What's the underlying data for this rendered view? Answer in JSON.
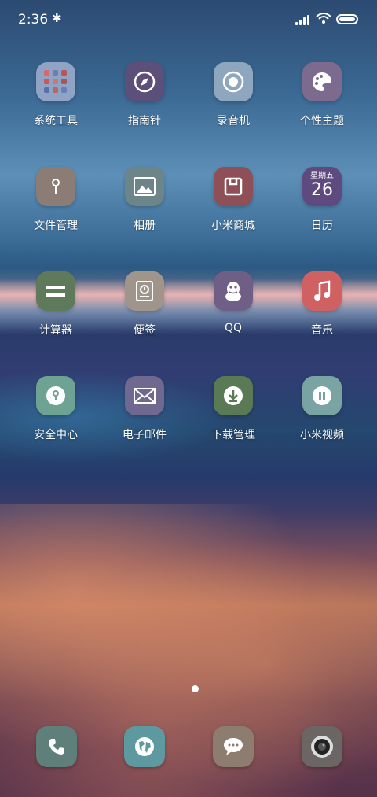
{
  "status_bar": {
    "time": "2:36",
    "bluetooth_icon": "bluetooth-icon"
  },
  "rows": [
    [
      {
        "label": "系统工具",
        "icon": "folder-grid-icon",
        "color": "#8fa3c4"
      },
      {
        "label": "指南针",
        "icon": "compass-icon",
        "color": "#5c4f7a"
      },
      {
        "label": "录音机",
        "icon": "recorder-icon",
        "color": "#8fa6bf"
      },
      {
        "label": "个性主题",
        "icon": "palette-icon",
        "color": "#7c6b8f"
      }
    ],
    [
      {
        "label": "文件管理",
        "icon": "file-manager-icon",
        "color": "#8b7c76"
      },
      {
        "label": "相册",
        "icon": "gallery-icon",
        "color": "#6b8588"
      },
      {
        "label": "小米商城",
        "icon": "mi-store-icon",
        "color": "#8f4f57"
      },
      {
        "label": "日历",
        "icon": "calendar-icon",
        "color": "#5e4a7e",
        "weekday": "星期五",
        "day": "26"
      }
    ],
    [
      {
        "label": "计算器",
        "icon": "calculator-icon",
        "color": "#5e7a5a"
      },
      {
        "label": "便签",
        "icon": "notes-icon",
        "color": "#a0958b"
      },
      {
        "label": "QQ",
        "icon": "qq-penguin-icon",
        "color": "#6f5e86"
      },
      {
        "label": "音乐",
        "icon": "music-note-icon",
        "color": "#cf6162"
      }
    ],
    [
      {
        "label": "安全中心",
        "icon": "security-icon",
        "color": "#6ea293"
      },
      {
        "label": "电子邮件",
        "icon": "mail-icon",
        "color": "#6f6890"
      },
      {
        "label": "下载管理",
        "icon": "download-icon",
        "color": "#5a7a55"
      },
      {
        "label": "小米视频",
        "icon": "video-icon",
        "color": "#7aa3a3"
      }
    ]
  ],
  "dock": [
    {
      "icon": "phone-icon",
      "color": "#5e7f7a"
    },
    {
      "icon": "browser-globe-icon",
      "color": "#5f99a0"
    },
    {
      "icon": "messages-icon",
      "color": "#8d7c70"
    },
    {
      "icon": "camera-icon",
      "color": "#6b6563"
    }
  ]
}
